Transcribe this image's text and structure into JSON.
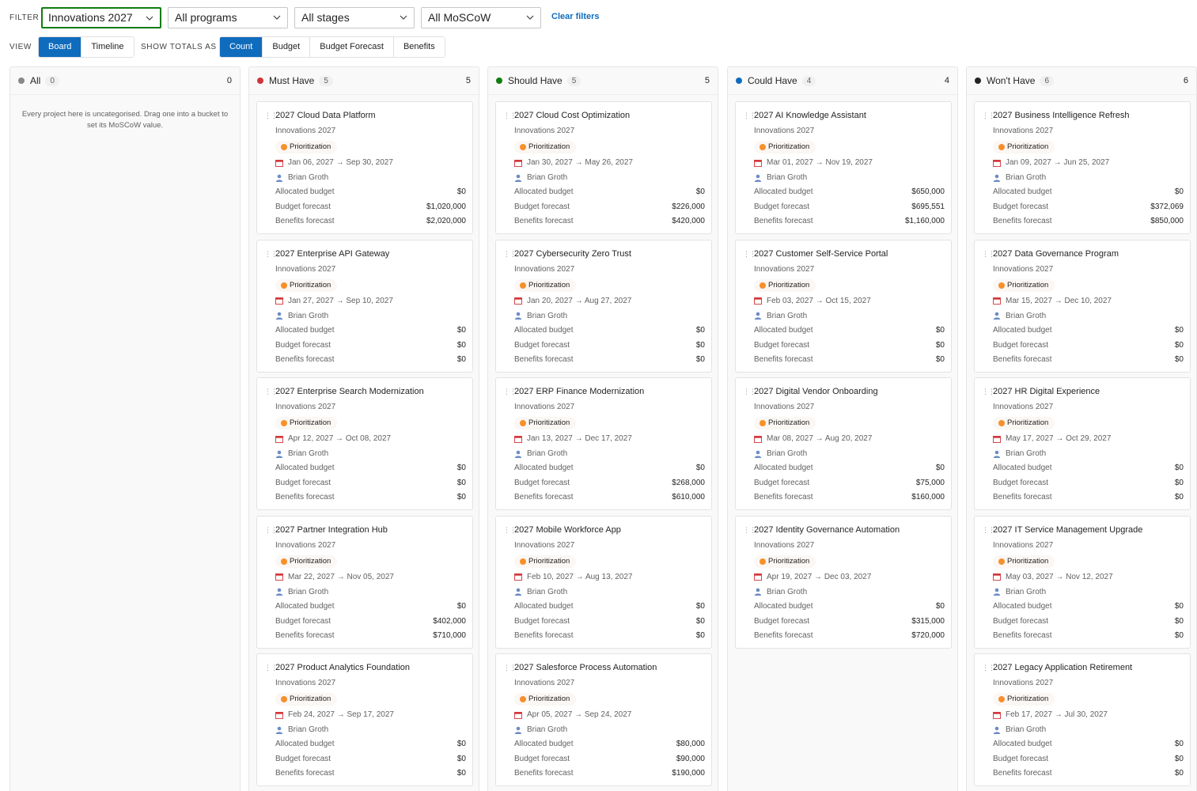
{
  "filter": {
    "label": "FILTER",
    "program_group": "Innovations 2027",
    "programs": "All programs",
    "stages": "All stages",
    "moscow": "All MoSCoW",
    "clear": "Clear filters"
  },
  "view": {
    "label": "VIEW",
    "modes": [
      "Board",
      "Timeline"
    ],
    "active_mode": "Board",
    "show_totals_label": "SHOW TOTALS AS",
    "totals": [
      "Count",
      "Budget",
      "Budget Forecast",
      "Benefits"
    ],
    "active_total": "Count"
  },
  "labels": {
    "allocated": "Allocated budget",
    "forecast": "Budget forecast",
    "benefits": "Benefits forecast"
  },
  "columns": [
    {
      "name": "All",
      "count": "0",
      "total": "0",
      "color": "#8a8886",
      "empty_note": "Every project here is uncategorised. Drag one into a bucket to set its MoSCoW value.",
      "cards": []
    },
    {
      "name": "Must Have",
      "count": "5",
      "total": "5",
      "color": "#d13438",
      "cards": [
        {
          "title": "2027 Cloud Data Platform",
          "program": "Innovations 2027",
          "stage": "Prioritization",
          "dates": "Jan 06, 2027 → Sep 30, 2027",
          "owner": "Brian Groth",
          "allocated": "$0",
          "forecast": "$1,020,000",
          "benefits": "$2,020,000"
        },
        {
          "title": "2027 Enterprise API Gateway",
          "program": "Innovations 2027",
          "stage": "Prioritization",
          "dates": "Jan 27, 2027 → Sep 10, 2027",
          "owner": "Brian Groth",
          "allocated": "$0",
          "forecast": "$0",
          "benefits": "$0"
        },
        {
          "title": "2027 Enterprise Search Modernization",
          "program": "Innovations 2027",
          "stage": "Prioritization",
          "dates": "Apr 12, 2027 → Oct 08, 2027",
          "owner": "Brian Groth",
          "allocated": "$0",
          "forecast": "$0",
          "benefits": "$0"
        },
        {
          "title": "2027 Partner Integration Hub",
          "program": "Innovations 2027",
          "stage": "Prioritization",
          "dates": "Mar 22, 2027 → Nov 05, 2027",
          "owner": "Brian Groth",
          "allocated": "$0",
          "forecast": "$402,000",
          "benefits": "$710,000"
        },
        {
          "title": "2027 Product Analytics Foundation",
          "program": "Innovations 2027",
          "stage": "Prioritization",
          "dates": "Feb 24, 2027 → Sep 17, 2027",
          "owner": "Brian Groth",
          "allocated": "$0",
          "forecast": "$0",
          "benefits": "$0"
        }
      ]
    },
    {
      "name": "Should Have",
      "count": "5",
      "total": "5",
      "color": "#107c10",
      "cards": [
        {
          "title": "2027 Cloud Cost Optimization",
          "program": "Innovations 2027",
          "stage": "Prioritization",
          "dates": "Jan 30, 2027 → May 26, 2027",
          "owner": "Brian Groth",
          "allocated": "$0",
          "forecast": "$226,000",
          "benefits": "$420,000"
        },
        {
          "title": "2027 Cybersecurity Zero Trust",
          "program": "Innovations 2027",
          "stage": "Prioritization",
          "dates": "Jan 20, 2027 → Aug 27, 2027",
          "owner": "Brian Groth",
          "allocated": "$0",
          "forecast": "$0",
          "benefits": "$0"
        },
        {
          "title": "2027 ERP Finance Modernization",
          "program": "Innovations 2027",
          "stage": "Prioritization",
          "dates": "Jan 13, 2027 → Dec 17, 2027",
          "owner": "Brian Groth",
          "allocated": "$0",
          "forecast": "$268,000",
          "benefits": "$610,000"
        },
        {
          "title": "2027 Mobile Workforce App",
          "program": "Innovations 2027",
          "stage": "Prioritization",
          "dates": "Feb 10, 2027 → Aug 13, 2027",
          "owner": "Brian Groth",
          "allocated": "$0",
          "forecast": "$0",
          "benefits": "$0"
        },
        {
          "title": "2027 Salesforce Process Automation",
          "program": "Innovations 2027",
          "stage": "Prioritization",
          "dates": "Apr 05, 2027 → Sep 24, 2027",
          "owner": "Brian Groth",
          "allocated": "$80,000",
          "forecast": "$90,000",
          "benefits": "$190,000"
        }
      ]
    },
    {
      "name": "Could Have",
      "count": "4",
      "total": "4",
      "color": "#0f6cbd",
      "cards": [
        {
          "title": "2027 AI Knowledge Assistant",
          "program": "Innovations 2027",
          "stage": "Prioritization",
          "dates": "Mar 01, 2027 → Nov 19, 2027",
          "owner": "Brian Groth",
          "allocated": "$650,000",
          "forecast": "$695,551",
          "benefits": "$1,160,000"
        },
        {
          "title": "2027 Customer Self-Service Portal",
          "program": "Innovations 2027",
          "stage": "Prioritization",
          "dates": "Feb 03, 2027 → Oct 15, 2027",
          "owner": "Brian Groth",
          "allocated": "$0",
          "forecast": "$0",
          "benefits": "$0"
        },
        {
          "title": "2027 Digital Vendor Onboarding",
          "program": "Innovations 2027",
          "stage": "Prioritization",
          "dates": "Mar 08, 2027 → Aug 20, 2027",
          "owner": "Brian Groth",
          "allocated": "$0",
          "forecast": "$75,000",
          "benefits": "$160,000"
        },
        {
          "title": "2027 Identity Governance Automation",
          "program": "Innovations 2027",
          "stage": "Prioritization",
          "dates": "Apr 19, 2027 → Dec 03, 2027",
          "owner": "Brian Groth",
          "allocated": "$0",
          "forecast": "$315,000",
          "benefits": "$720,000"
        }
      ]
    },
    {
      "name": "Won't Have",
      "count": "6",
      "total": "6",
      "color": "#242424",
      "cards": [
        {
          "title": "2027 Business Intelligence Refresh",
          "program": "Innovations 2027",
          "stage": "Prioritization",
          "dates": "Jan 09, 2027 → Jun 25, 2027",
          "owner": "Brian Groth",
          "allocated": "$0",
          "forecast": "$372,069",
          "benefits": "$850,000"
        },
        {
          "title": "2027 Data Governance Program",
          "program": "Innovations 2027",
          "stage": "Prioritization",
          "dates": "Mar 15, 2027 → Dec 10, 2027",
          "owner": "Brian Groth",
          "allocated": "$0",
          "forecast": "$0",
          "benefits": "$0"
        },
        {
          "title": "2027 HR Digital Experience",
          "program": "Innovations 2027",
          "stage": "Prioritization",
          "dates": "May 17, 2027 → Oct 29, 2027",
          "owner": "Brian Groth",
          "allocated": "$0",
          "forecast": "$0",
          "benefits": "$0"
        },
        {
          "title": "2027 IT Service Management Upgrade",
          "program": "Innovations 2027",
          "stage": "Prioritization",
          "dates": "May 03, 2027 → Nov 12, 2027",
          "owner": "Brian Groth",
          "allocated": "$0",
          "forecast": "$0",
          "benefits": "$0"
        },
        {
          "title": "2027 Legacy Application Retirement",
          "program": "Innovations 2027",
          "stage": "Prioritization",
          "dates": "Feb 17, 2027 → Jul 30, 2027",
          "owner": "Brian Groth",
          "allocated": "$0",
          "forecast": "$0",
          "benefits": "$0"
        }
      ]
    }
  ]
}
